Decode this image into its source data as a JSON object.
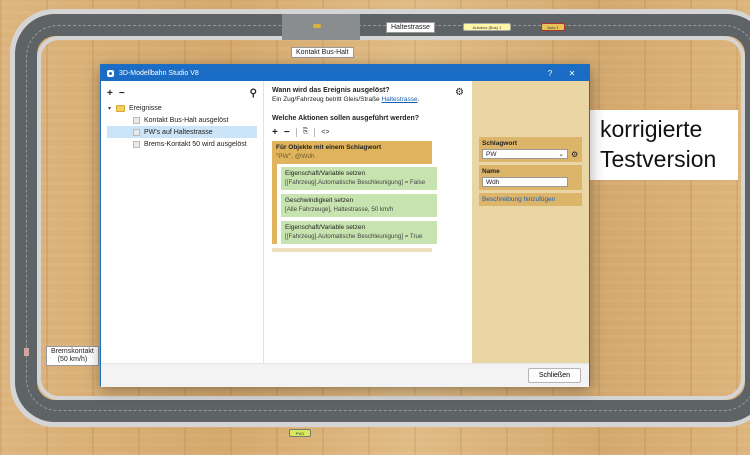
{
  "scene": {
    "labels": {
      "haltestrasse": "Haltestrasse",
      "kontakt_bus_halt": "Kontakt Bus-Halt",
      "bremskontakt": "Bremskontakt",
      "bremskontakt_speed": "(50 km/h)"
    },
    "cars": {
      "bus_yellow": "Autobus (Bus) 1",
      "car_red": "Auto 1",
      "car_bottom": "PW1"
    },
    "note": {
      "line1": "korrigierte",
      "line2": "Testversion"
    },
    "colors": {
      "road": "#5e6366",
      "wood": "#d8b27a",
      "accent": "#1b6cc4"
    }
  },
  "dialog": {
    "title": "3D-Modellbahn Studio V8",
    "help_label": "?",
    "close_label": "✕",
    "left": {
      "add": "+",
      "remove": "−",
      "search_icon": "⚲",
      "folder": "Ereignisse",
      "events": [
        "Kontakt Bus-Halt ausgelöst",
        "PW's auf Haltestrasse",
        "Brems-Kontakt 50 wird ausgelöst"
      ]
    },
    "middle": {
      "question": "Wann wird das Ereignis ausgelöst?",
      "trigger_prefix": "Ein Zug/Fahrzeug betritt Gleis/Straße",
      "trigger_link": "Haltestrasse",
      "trigger_suffix": ".",
      "actions_title": "Welche Aktionen sollen ausgeführt werden?",
      "toolbar": {
        "add": "+",
        "remove": "−",
        "copy": "⎘",
        "code": "<>"
      },
      "block": {
        "head": "Für Objekte mit einem Schlagwort",
        "sub": "\"PW\", @Wdh"
      },
      "actions": [
        {
          "title": "Eigenschaft/Variable setzen",
          "detail": "[[Fahrzeug].Automatische Beschleunigung] = False"
        },
        {
          "title": "Geschwindigkeit setzen",
          "detail": "[Alle Fahrzeuge], Haltestrasse, 50 km/h"
        },
        {
          "title": "Eigenschaft/Variable setzen",
          "detail": "[[Fahrzeug].Automatische Beschleunigung] = True"
        }
      ]
    },
    "right": {
      "schlagwort_label": "Schlagwort",
      "schlagwort_value": "PW",
      "name_label": "Name",
      "name_value": "Wdh",
      "add_description": "Beschreibung hinzufügen"
    },
    "footer": {
      "close_button": "Schließen"
    }
  }
}
